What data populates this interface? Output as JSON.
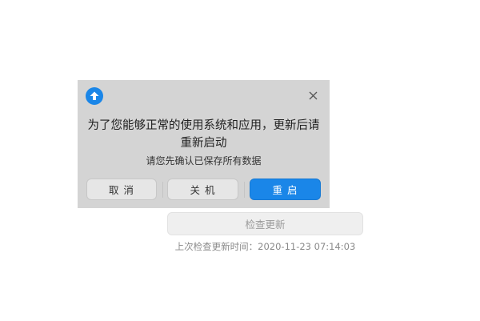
{
  "dialog": {
    "icon": "upload-arrow-icon",
    "title": "为了您能够正常的使用系统和应用，更新后请重新启动",
    "subtitle": "请您先确认已保存所有数据",
    "buttons": {
      "cancel": "取 消",
      "shutdown": "关 机",
      "restart": "重 启"
    },
    "close_icon": "close-icon",
    "accent_color": "#1a86e8"
  },
  "update_panel": {
    "check_button": "检查更新",
    "last_check_text": "上次检查更新时间：2020-11-23 07:14:03"
  }
}
